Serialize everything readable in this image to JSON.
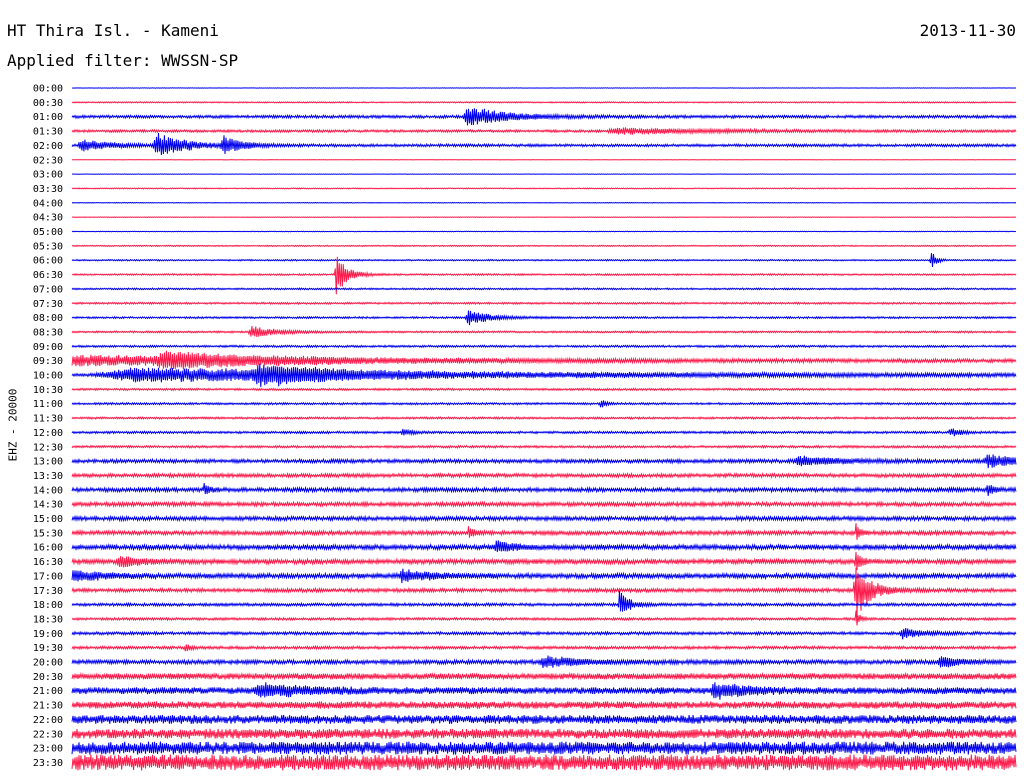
{
  "header": {
    "station": "HT Thira Isl. - Kameni",
    "date": "2013-11-30",
    "filter": "Applied filter: WWSSN-SP"
  },
  "channel_label": "EHZ - 20000",
  "chart_data": {
    "type": "line",
    "title": "HT Thira Isl. - Kameni",
    "subtitle": "Applied filter: WWSSN-SP",
    "ylabel": "EHZ - 20000",
    "colors": [
      "#0000ee",
      "#ff1a4a"
    ],
    "ytick_labels": [
      "00:00",
      "00:30",
      "01:00",
      "01:30",
      "02:00",
      "02:30",
      "03:00",
      "03:30",
      "04:00",
      "04:30",
      "05:00",
      "05:30",
      "06:00",
      "06:30",
      "07:00",
      "07:30",
      "08:00",
      "08:30",
      "09:00",
      "09:30",
      "10:00",
      "10:30",
      "11:00",
      "11:30",
      "12:00",
      "12:30",
      "13:00",
      "13:30",
      "14:00",
      "14:30",
      "15:00",
      "15:30",
      "16:00",
      "16:30",
      "17:00",
      "17:30",
      "18:00",
      "18:30",
      "19:00",
      "19:30",
      "20:00",
      "20:30",
      "21:00",
      "21:30",
      "22:00",
      "22:30",
      "23:00",
      "23:30"
    ],
    "series": [
      {
        "row": "00:00",
        "color": "#0000ee",
        "noise": 0.2,
        "events": []
      },
      {
        "row": "00:30",
        "color": "#ff1a4a",
        "noise": 0.6,
        "events": []
      },
      {
        "row": "01:00",
        "color": "#0000ee",
        "noise": 1.4,
        "events": [
          {
            "t": 0.42,
            "amp": 10,
            "dur": 0.04
          }
        ]
      },
      {
        "row": "01:30",
        "color": "#ff1a4a",
        "noise": 1.2,
        "events": [
          {
            "t": 0.58,
            "amp": 3,
            "dur": 0.1
          }
        ]
      },
      {
        "row": "02:00",
        "color": "#0000ee",
        "noise": 1.3,
        "events": [
          {
            "t": 0.01,
            "amp": 6,
            "dur": 0.03
          },
          {
            "t": 0.09,
            "amp": 13,
            "dur": 0.03
          },
          {
            "t": 0.16,
            "amp": 9,
            "dur": 0.02
          }
        ]
      },
      {
        "row": "02:30",
        "color": "#ff1a4a",
        "noise": 0.2,
        "events": []
      },
      {
        "row": "03:00",
        "color": "#0000ee",
        "noise": 0.2,
        "events": []
      },
      {
        "row": "03:30",
        "color": "#ff1a4a",
        "noise": 0.5,
        "events": []
      },
      {
        "row": "04:00",
        "color": "#0000ee",
        "noise": 0.3,
        "events": []
      },
      {
        "row": "04:30",
        "color": "#ff1a4a",
        "noise": 0.3,
        "events": []
      },
      {
        "row": "05:00",
        "color": "#0000ee",
        "noise": 0.3,
        "events": []
      },
      {
        "row": "05:30",
        "color": "#ff1a4a",
        "noise": 0.6,
        "events": []
      },
      {
        "row": "06:00",
        "color": "#0000ee",
        "noise": 0.7,
        "events": [
          {
            "t": 0.91,
            "amp": 10,
            "dur": 0.005
          }
        ]
      },
      {
        "row": "06:30",
        "color": "#ff1a4a",
        "noise": 0.8,
        "events": [
          {
            "t": 0.28,
            "amp": 20,
            "dur": 0.012
          }
        ]
      },
      {
        "row": "07:00",
        "color": "#0000ee",
        "noise": 0.8,
        "events": []
      },
      {
        "row": "07:30",
        "color": "#ff1a4a",
        "noise": 0.9,
        "events": []
      },
      {
        "row": "08:00",
        "color": "#0000ee",
        "noise": 0.9,
        "events": [
          {
            "t": 0.42,
            "amp": 7,
            "dur": 0.025
          }
        ]
      },
      {
        "row": "08:30",
        "color": "#ff1a4a",
        "noise": 0.9,
        "events": [
          {
            "t": 0.19,
            "amp": 6,
            "dur": 0.025
          }
        ]
      },
      {
        "row": "09:00",
        "color": "#0000ee",
        "noise": 1.0,
        "events": []
      },
      {
        "row": "09:30",
        "color": "#ff1a4a",
        "noise": 1.6,
        "events": [
          {
            "t": 0.0,
            "amp": 5,
            "dur": 0.3
          },
          {
            "t": 0.1,
            "amp": 6,
            "dur": 0.1
          }
        ]
      },
      {
        "row": "10:00",
        "color": "#0000ee",
        "noise": 1.6,
        "events": [
          {
            "t": 0.07,
            "amp": 7,
            "dur": 0.34
          },
          {
            "t": 0.2,
            "amp": 8,
            "dur": 0.06
          }
        ]
      },
      {
        "row": "10:30",
        "color": "#ff1a4a",
        "noise": 1.0,
        "events": []
      },
      {
        "row": "11:00",
        "color": "#0000ee",
        "noise": 1.0,
        "events": [
          {
            "t": 0.56,
            "amp": 6,
            "dur": 0.004
          }
        ]
      },
      {
        "row": "11:30",
        "color": "#ff1a4a",
        "noise": 1.0,
        "events": []
      },
      {
        "row": "12:00",
        "color": "#0000ee",
        "noise": 1.1,
        "events": [
          {
            "t": 0.35,
            "amp": 4,
            "dur": 0.01
          },
          {
            "t": 0.93,
            "amp": 5,
            "dur": 0.01
          }
        ]
      },
      {
        "row": "12:30",
        "color": "#ff1a4a",
        "noise": 1.1,
        "events": []
      },
      {
        "row": "13:00",
        "color": "#0000ee",
        "noise": 1.8,
        "events": [
          {
            "t": 0.77,
            "amp": 5,
            "dur": 0.04
          },
          {
            "t": 0.97,
            "amp": 7,
            "dur": 0.03
          }
        ]
      },
      {
        "row": "13:30",
        "color": "#ff1a4a",
        "noise": 1.8,
        "events": []
      },
      {
        "row": "14:00",
        "color": "#0000ee",
        "noise": 2.0,
        "events": [
          {
            "t": 0.14,
            "amp": 6,
            "dur": 0.006
          },
          {
            "t": 0.97,
            "amp": 8,
            "dur": 0.006
          }
        ]
      },
      {
        "row": "14:30",
        "color": "#ff1a4a",
        "noise": 2.0,
        "events": []
      },
      {
        "row": "15:00",
        "color": "#0000ee",
        "noise": 2.0,
        "events": []
      },
      {
        "row": "15:30",
        "color": "#ff1a4a",
        "noise": 2.0,
        "events": [
          {
            "t": 0.42,
            "amp": 7,
            "dur": 0.006
          },
          {
            "t": 0.83,
            "amp": 10,
            "dur": 0.004
          }
        ]
      },
      {
        "row": "16:00",
        "color": "#0000ee",
        "noise": 2.4,
        "events": [
          {
            "t": 0.45,
            "amp": 6,
            "dur": 0.02
          }
        ]
      },
      {
        "row": "16:30",
        "color": "#ff1a4a",
        "noise": 2.4,
        "events": [
          {
            "t": 0.05,
            "amp": 6,
            "dur": 0.02
          },
          {
            "t": 0.83,
            "amp": 14,
            "dur": 0.005
          }
        ]
      },
      {
        "row": "17:00",
        "color": "#0000ee",
        "noise": 2.4,
        "events": [
          {
            "t": 0.0,
            "amp": 6,
            "dur": 0.03
          },
          {
            "t": 0.35,
            "amp": 6,
            "dur": 0.03
          }
        ]
      },
      {
        "row": "17:30",
        "color": "#ff1a4a",
        "noise": 1.8,
        "events": [
          {
            "t": 0.83,
            "amp": 30,
            "dur": 0.015
          }
        ]
      },
      {
        "row": "18:00",
        "color": "#0000ee",
        "noise": 1.4,
        "events": [
          {
            "t": 0.58,
            "amp": 14,
            "dur": 0.01
          }
        ]
      },
      {
        "row": "18:30",
        "color": "#ff1a4a",
        "noise": 1.2,
        "events": [
          {
            "t": 0.83,
            "amp": 12,
            "dur": 0.004
          }
        ]
      },
      {
        "row": "19:00",
        "color": "#0000ee",
        "noise": 1.4,
        "events": [
          {
            "t": 0.88,
            "amp": 6,
            "dur": 0.02
          }
        ]
      },
      {
        "row": "19:30",
        "color": "#ff1a4a",
        "noise": 1.4,
        "events": [
          {
            "t": 0.12,
            "amp": 5,
            "dur": 0.005
          }
        ]
      },
      {
        "row": "20:00",
        "color": "#0000ee",
        "noise": 2.0,
        "events": [
          {
            "t": 0.5,
            "amp": 6,
            "dur": 0.04
          },
          {
            "t": 0.92,
            "amp": 6,
            "dur": 0.02
          }
        ]
      },
      {
        "row": "20:30",
        "color": "#ff1a4a",
        "noise": 3.0,
        "events": []
      },
      {
        "row": "21:00",
        "color": "#0000ee",
        "noise": 3.4,
        "events": [
          {
            "t": 0.2,
            "amp": 6,
            "dur": 0.05
          },
          {
            "t": 0.68,
            "amp": 8,
            "dur": 0.03
          }
        ]
      },
      {
        "row": "21:30",
        "color": "#ff1a4a",
        "noise": 3.6,
        "events": []
      },
      {
        "row": "22:00",
        "color": "#0000ee",
        "noise": 4.4,
        "events": []
      },
      {
        "row": "22:30",
        "color": "#ff1a4a",
        "noise": 5.0,
        "events": []
      },
      {
        "row": "23:00",
        "color": "#0000ee",
        "noise": 6.5,
        "events": []
      },
      {
        "row": "23:30",
        "color": "#ff1a4a",
        "noise": 8.0,
        "events": []
      }
    ]
  }
}
